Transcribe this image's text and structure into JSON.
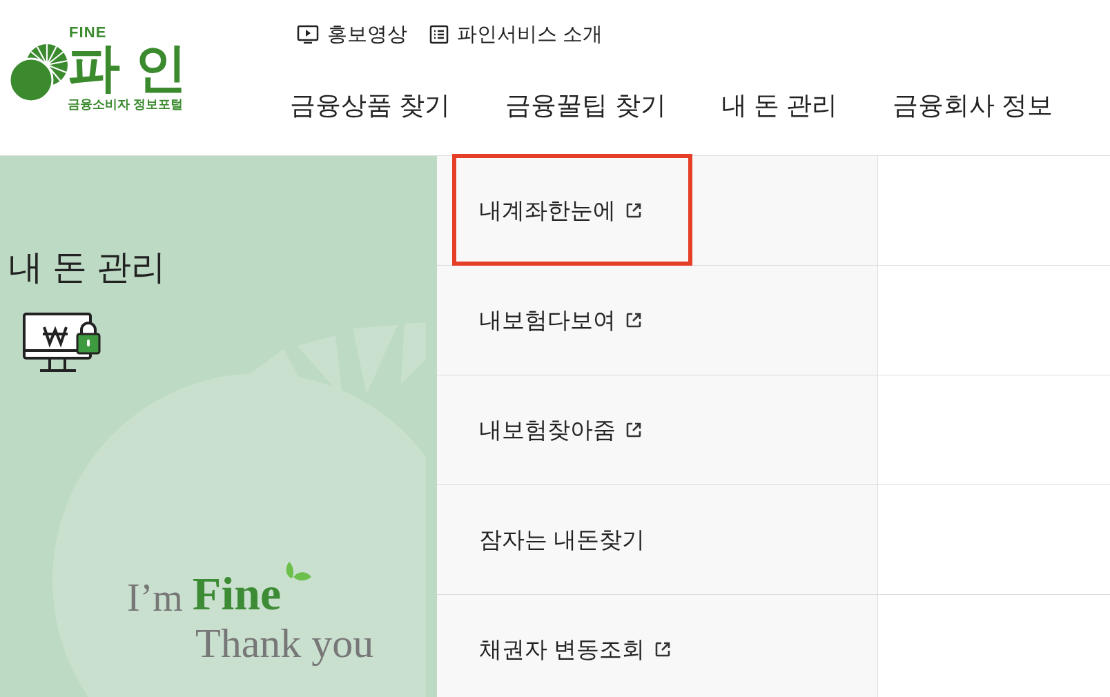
{
  "logo": {
    "top": "FINE",
    "main": "파 인",
    "sub": "금융소비자 정보포털"
  },
  "top_links": [
    {
      "label": "홍보영상",
      "kind": "video"
    },
    {
      "label": "파인서비스 소개",
      "kind": "list"
    }
  ],
  "nav": [
    "금융상품 찾기",
    "금융꿀팁 찾기",
    "내 돈 관리",
    "금융회사 정보"
  ],
  "panel": {
    "title": "내 돈 관리",
    "slogan_1": "I’m",
    "slogan_2": "Fine",
    "slogan_3": "Thank you"
  },
  "items": [
    {
      "label": "내계좌한눈에",
      "external": true,
      "highlighted": true
    },
    {
      "label": "내보험다보여",
      "external": true,
      "highlighted": false
    },
    {
      "label": "내보험찾아줌",
      "external": true,
      "highlighted": false
    },
    {
      "label": "잠자는 내돈찾기",
      "external": false,
      "highlighted": false
    },
    {
      "label": "채권자 변동조회",
      "external": true,
      "highlighted": false
    }
  ]
}
